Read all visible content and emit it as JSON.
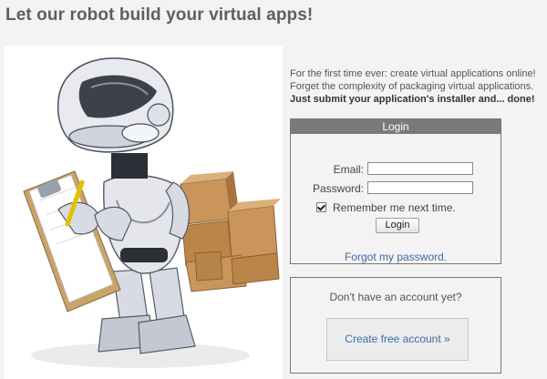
{
  "page": {
    "headline": "Let our robot build your virtual apps!"
  },
  "intro": {
    "line1": "For the first time ever: create virtual applications online!",
    "line2": "Forget the complexity of packaging virtual applications.",
    "line3": "Just submit your application's installer and... done!"
  },
  "login": {
    "title": "Login",
    "email_label": "Email:",
    "email_value": "",
    "password_label": "Password:",
    "password_value": "",
    "remember_label": "Remember me next time.",
    "remember_checked": true,
    "submit_label": "Login",
    "forgot_label": "Forgot my password."
  },
  "signup": {
    "prompt": "Don't have an account yet?",
    "button_label": "Create free account »"
  },
  "illustration": {
    "subject": "robot-with-clipboard-and-boxes"
  },
  "colors": {
    "background": "#f3f3f3",
    "panel_header": "#7a7a7a",
    "link": "#3a6ea5",
    "headline": "#5f5f5f"
  }
}
